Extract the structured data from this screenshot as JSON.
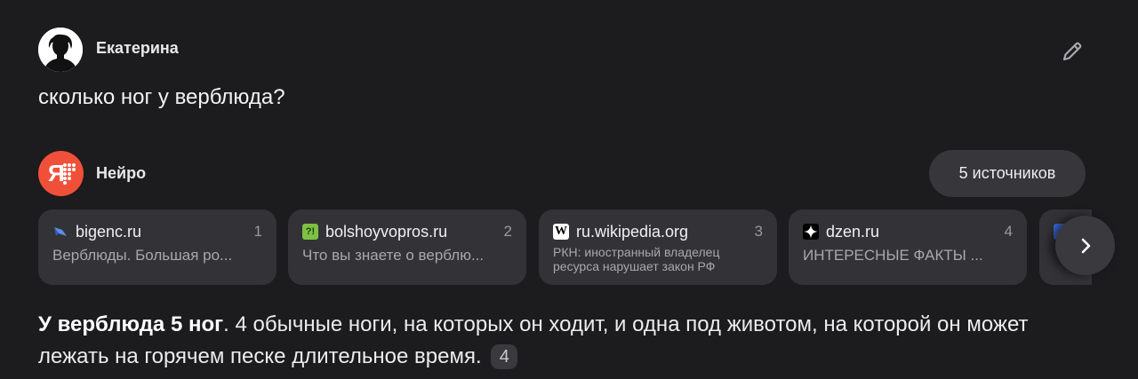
{
  "user": {
    "name": "Екатерина",
    "question": "сколько ног у верблюда?"
  },
  "assistant": {
    "name": "Нейро",
    "logo_text": "Я",
    "sources_button": "5 источников"
  },
  "sources": [
    {
      "domain": "bigenc.ru",
      "num": "1",
      "snippet": "Верблюды. Большая ро...",
      "icon": "bigenc-icon"
    },
    {
      "domain": "bolshoyvopros.ru",
      "num": "2",
      "snippet": "Что вы знаете о верблю...",
      "icon": "bolshoyvopros-icon",
      "icon_text": "?!"
    },
    {
      "domain": "ru.wikipedia.org",
      "num": "3",
      "snippet": "РКН: иностранный владелец ресурса нарушает закон РФ",
      "icon": "wikipedia-icon",
      "icon_text": "W"
    },
    {
      "domain": "dzen.ru",
      "num": "4",
      "snippet": "ИНТЕРЕСНЫЕ ФАКТЫ ...",
      "icon": "dzen-icon"
    }
  ],
  "answer": {
    "bold": "У верблюда 5 ног",
    "text": ". 4 обычные ноги, на которых он ходит, и одна под животом, на которой он может лежать на горячем песке длительное время.",
    "citation": "4"
  },
  "colors": {
    "background": "#1c1b1e",
    "card": "#333236",
    "neuro_accent": "#f0503a"
  }
}
